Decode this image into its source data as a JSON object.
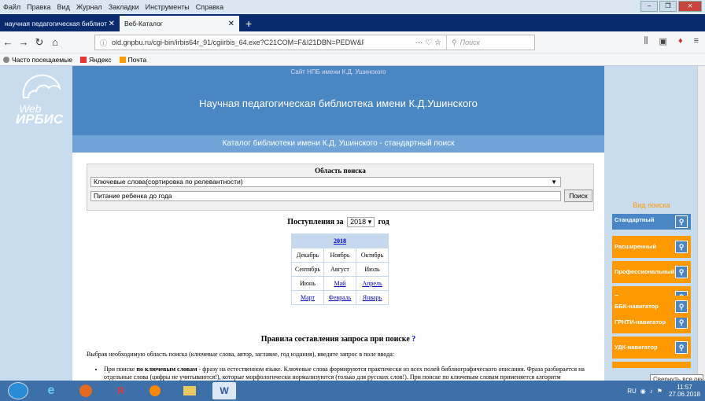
{
  "menubar": {
    "items": [
      "Файл",
      "Правка",
      "Вид",
      "Журнал",
      "Закладки",
      "Инструменты",
      "Справка"
    ]
  },
  "tabs": [
    {
      "label": "научная педагогическая библиот",
      "active": false
    },
    {
      "label": "Веб-Каталог",
      "active": true
    }
  ],
  "nav": {
    "url": "old.gnpbu.ru/cgi-bin/irbis64r_91/cgiirbis_64.exe?C21COM=F&I21DBN=PEDW&P21DBN=PEDW&S",
    "search_placeholder": "Поиск",
    "page_actions": "··· ♡ ☆"
  },
  "bookmarks": [
    "Часто посещаемые",
    "Яндекс",
    "Почта"
  ],
  "site": {
    "top_link": "Сайт НПБ имени К.Д. Ушинского",
    "title": "Научная педагогическая библиотека имени К.Д.Ушинского",
    "logo_web": "Web",
    "logo_irbis": "ИРБИС",
    "catalog_title": "Каталог библиотеки имени К.Д. Ушинского - стандартный поиск"
  },
  "search": {
    "area_label": "Область поиска",
    "field_value": "Ключевые слова(сортировка по релевантности)",
    "query_value": "Питание ребенка до года",
    "button": "Поиск"
  },
  "arrivals": {
    "before": "Поступления за",
    "year": "2018",
    "after": "год"
  },
  "calendar": {
    "year": "2018",
    "rows": [
      [
        "Декабрь",
        "Ноябрь",
        "Октябрь"
      ],
      [
        "Сентябрь",
        "Август",
        "Июль"
      ],
      [
        "Июнь",
        "Май",
        "Апрель"
      ],
      [
        "Март",
        "Февраль",
        "Январь"
      ]
    ]
  },
  "rules": {
    "title": "Правила составления запроса при поиске",
    "help": "?",
    "intro": "Выбрав необходимую область поиска (ключевые слова, автор, заглавие, год издания), введите запрос в поле ввода:",
    "bullet_prefix": "При поиске ",
    "bullet_bold": "по ключевым словам",
    "bullet_text": " - фразу на естественном языке. Ключевые слова формируются практически из всех полей библиографического описания. Фраза разбирается на отдельные слова (цифры не учитываются!), которые морфологически нормализуются (только для русских слов!). При поиске по ключевым словам применяется алгоритм ранжирования найденных документов: список результатов поиска сортируется в порядке убывания ранга документа. Чем больше в найденном документе слов из запроса, чем эти слова ближе друг к другу и чем больше их суммарный вес - тем выше место документа в результате поиска."
  },
  "sidebar": {
    "title": "Вид поиска",
    "items": [
      "Стандартный",
      "Расширенный",
      "Профессиональный",
      "По словарю",
      "ГРНТИ-навигатор",
      "УДК-навигатор",
      "ББК-навигатор"
    ]
  },
  "tooltip": "Свернуть все окна",
  "clock": {
    "time": "11:57",
    "date": "27.06.2018"
  },
  "tray": {
    "lang": "RU"
  },
  "colors": {
    "accent": "#4b86c4",
    "orange": "#ff9900",
    "link": "#0000cc",
    "taskbar": "#3d6fa8"
  }
}
